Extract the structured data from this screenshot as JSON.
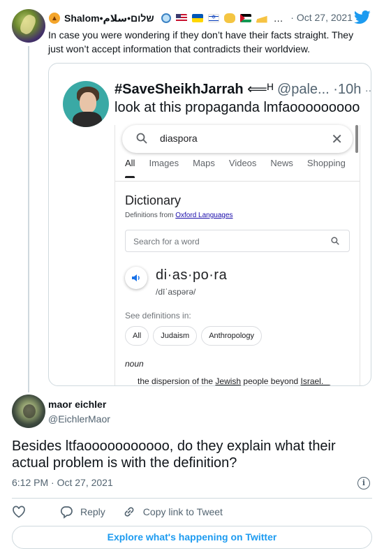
{
  "parent_tweet": {
    "display_name": "Shalom•שלום•سلام",
    "emoji_icons": [
      "lion-icon",
      "globe-icon",
      "us-flag-icon",
      "ukraine-flag-icon",
      "israel-flag-icon",
      "handshake-icon",
      "palestine-flag-icon",
      "cheese-icon"
    ],
    "ellipsis": "…",
    "date": "· Oct 27, 2021",
    "text": "In case you were wondering if they don’t have their facts straight. They just won’t accept information that contradicts their worldview."
  },
  "embedded_screenshot": {
    "display_name": "#SaveSheikhJarrah",
    "badge": "⟸ᴴ",
    "handle": "@pale...",
    "time": "·10h",
    "more": "···",
    "text": "look at this propaganda lmfaooooooooo",
    "google": {
      "query": "diaspora",
      "tabs": [
        "All",
        "Images",
        "Maps",
        "Videos",
        "News",
        "Shopping"
      ],
      "active_tab": "All",
      "dictionary_title": "Dictionary",
      "definitions_from_prefix": "Definitions from ",
      "definitions_source": "Oxford Languages",
      "search_placeholder": "Search for a word",
      "headword": "di·as·po·ra",
      "pronunciation": "/dīˈaspərə/",
      "see_definitions": "See definitions in:",
      "chips": [
        "All",
        "Judaism",
        "Anthropology"
      ],
      "part_of_speech": "noun",
      "definition_prefix": "the dispersion of the ",
      "definition_link1": "Jewish",
      "definition_middle": " people beyond ",
      "definition_link2": "Israel",
      "definition_suffix": "."
    }
  },
  "main_tweet": {
    "display_name": "maor eichler",
    "handle": "@EichlerMaor",
    "text": "Besides ltfaooooooooooo, do they explain what their actual problem is with the definition?",
    "timestamp": "6:12 PM · Oct 27, 2021",
    "info_label": "i"
  },
  "actions": {
    "reply_label": "Reply",
    "copy_link_label": "Copy link to Tweet"
  },
  "explore_label": "Explore what's happening on Twitter",
  "colors": {
    "twitter_blue": "#1d9bf0",
    "text_primary": "#0f1419",
    "text_secondary": "#536471",
    "border": "#cfd9de"
  }
}
